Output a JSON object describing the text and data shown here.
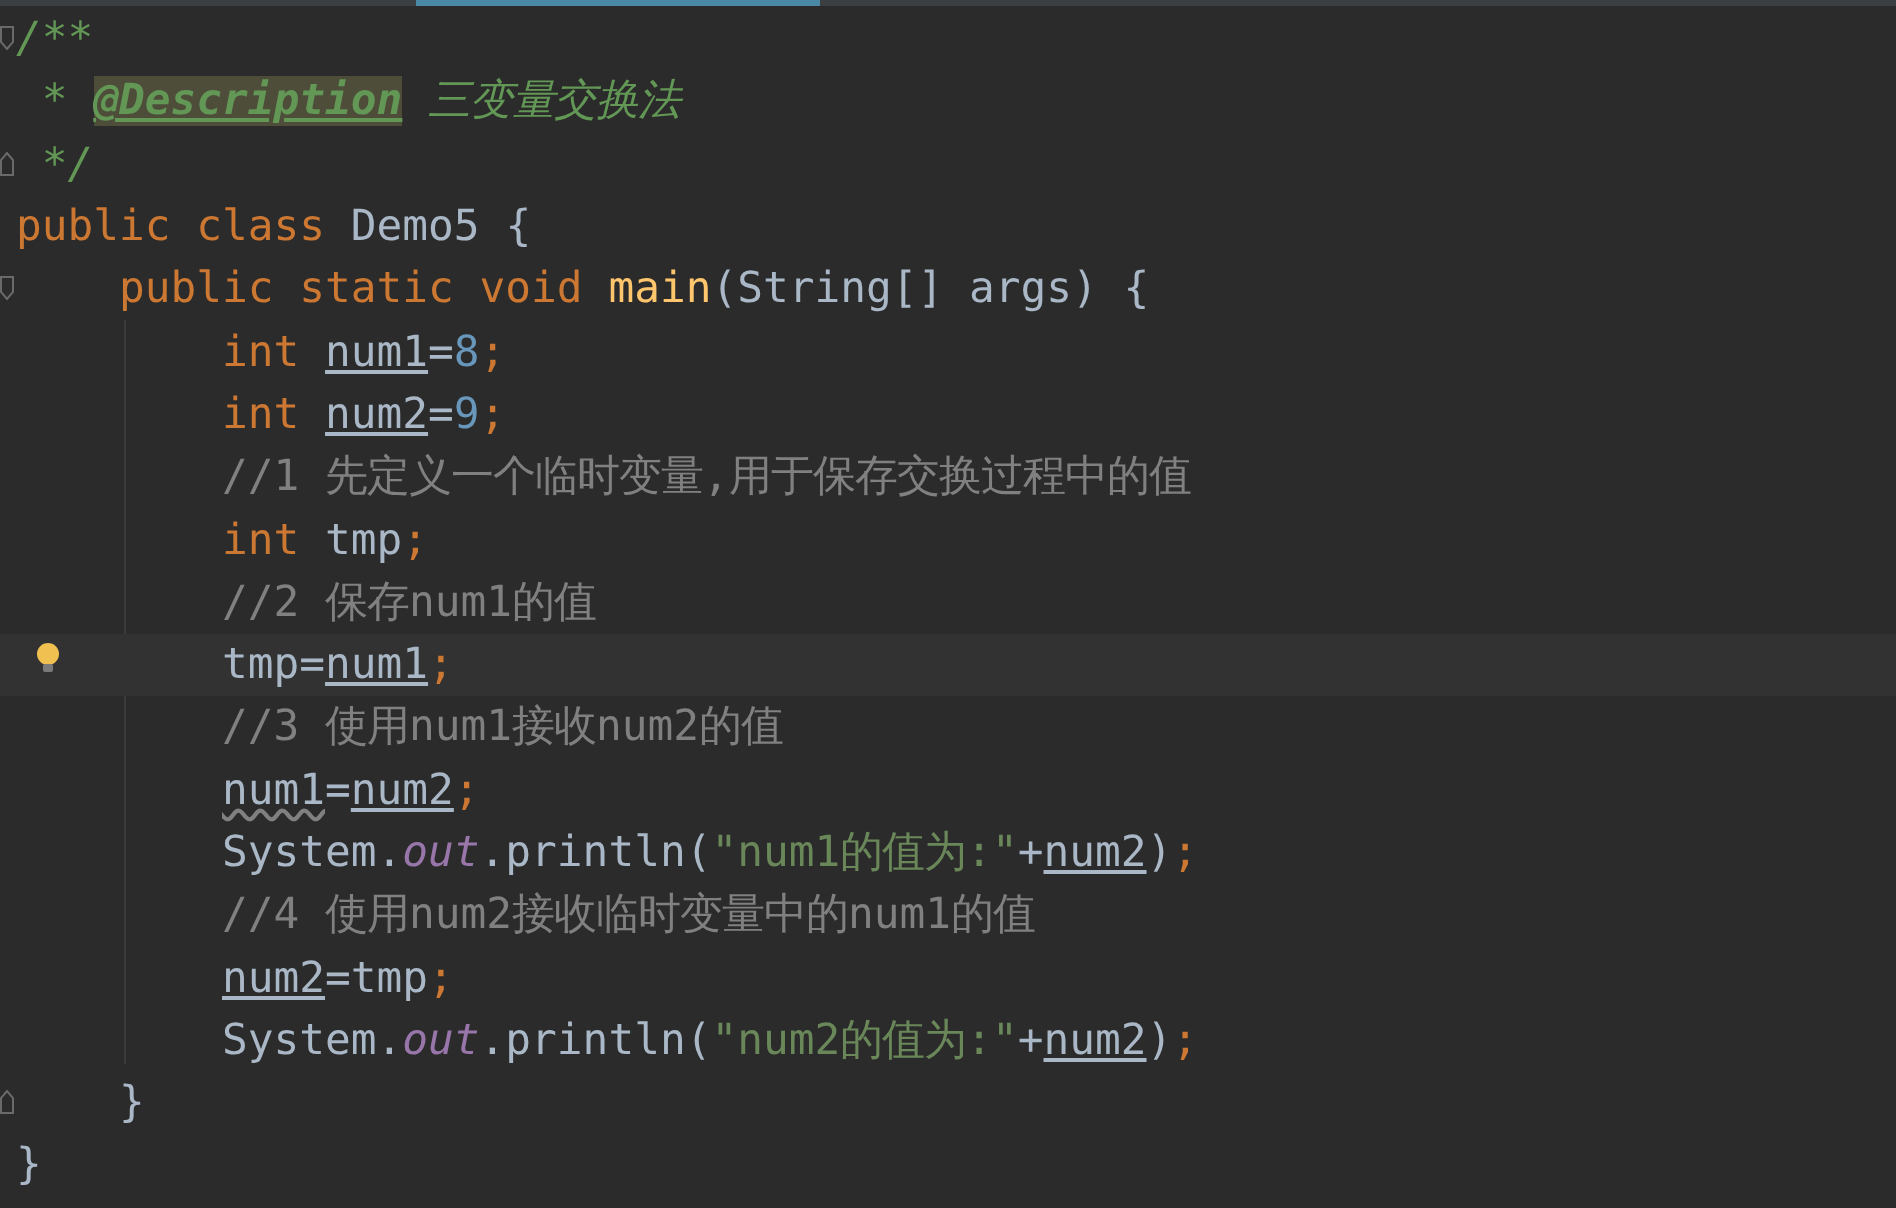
{
  "editor": {
    "lines": [
      {
        "fold_start": true,
        "fold_end": false,
        "current": false,
        "tokens": [
          {
            "kind": "doc",
            "text": "/**"
          }
        ]
      },
      {
        "fold_start": false,
        "fold_end": false,
        "current": false,
        "tokens": [
          {
            "kind": "doc",
            "text": " * "
          },
          {
            "kind": "doctag",
            "text": "@Description"
          },
          {
            "kind": "doc",
            "text": " 三变量交换法"
          }
        ]
      },
      {
        "fold_start": false,
        "fold_end": true,
        "current": false,
        "tokens": [
          {
            "kind": "doc",
            "text": " */"
          }
        ]
      },
      {
        "fold_start": false,
        "fold_end": false,
        "current": false,
        "tokens": [
          {
            "kind": "keyword",
            "text": "public class "
          },
          {
            "kind": "plain",
            "text": "Demo5 {"
          }
        ],
        "children": [
          {
            "fold_start": true,
            "fold_end": false,
            "current": false,
            "tokens": [
              {
                "kind": "keyword",
                "text": "public static void "
              },
              {
                "kind": "method",
                "text": "main"
              },
              {
                "kind": "plain",
                "text": "(String[] args) {"
              }
            ],
            "children": [
              {
                "fold_start": false,
                "fold_end": false,
                "current": false,
                "tokens": [
                  {
                    "kind": "keyword",
                    "text": "int "
                  },
                  {
                    "kind": "var",
                    "text": "num1"
                  },
                  {
                    "kind": "plain",
                    "text": "="
                  },
                  {
                    "kind": "number",
                    "text": "8"
                  },
                  {
                    "kind": "keyword",
                    "text": ";"
                  }
                ]
              },
              {
                "fold_start": false,
                "fold_end": false,
                "current": false,
                "tokens": [
                  {
                    "kind": "keyword",
                    "text": "int "
                  },
                  {
                    "kind": "var",
                    "text": "num2"
                  },
                  {
                    "kind": "plain",
                    "text": "="
                  },
                  {
                    "kind": "number",
                    "text": "9"
                  },
                  {
                    "kind": "keyword",
                    "text": ";"
                  }
                ]
              },
              {
                "fold_start": false,
                "fold_end": false,
                "current": false,
                "tokens": [
                  {
                    "kind": "comment",
                    "text": "//1 先定义一个临时变量,用于保存交换过程中的值"
                  }
                ]
              },
              {
                "fold_start": false,
                "fold_end": false,
                "current": false,
                "tokens": [
                  {
                    "kind": "keyword",
                    "text": "int "
                  },
                  {
                    "kind": "plain",
                    "text": "tmp"
                  },
                  {
                    "kind": "keyword",
                    "text": ";"
                  }
                ]
              },
              {
                "fold_start": false,
                "fold_end": false,
                "current": false,
                "tokens": [
                  {
                    "kind": "comment",
                    "text": "//2 保存num1的值"
                  }
                ]
              },
              {
                "fold_start": false,
                "fold_end": false,
                "current": true,
                "tokens": [
                  {
                    "kind": "plain",
                    "text": "tmp="
                  },
                  {
                    "kind": "var",
                    "text": "num1"
                  },
                  {
                    "kind": "keyword",
                    "text": ";"
                  }
                ]
              },
              {
                "fold_start": false,
                "fold_end": false,
                "current": false,
                "tokens": [
                  {
                    "kind": "comment",
                    "text": "//3 使用num1接收num2的值"
                  }
                ]
              },
              {
                "fold_start": false,
                "fold_end": false,
                "current": false,
                "tokens": [
                  {
                    "kind": "warnvar",
                    "text": "num1"
                  },
                  {
                    "kind": "plain",
                    "text": "="
                  },
                  {
                    "kind": "var",
                    "text": "num2"
                  },
                  {
                    "kind": "keyword",
                    "text": ";"
                  }
                ]
              },
              {
                "fold_start": false,
                "fold_end": false,
                "current": false,
                "tokens": [
                  {
                    "kind": "plain",
                    "text": "System."
                  },
                  {
                    "kind": "field",
                    "text": "out"
                  },
                  {
                    "kind": "plain",
                    "text": ".println("
                  },
                  {
                    "kind": "string",
                    "text": "\"num1的值为:\""
                  },
                  {
                    "kind": "plain",
                    "text": "+"
                  },
                  {
                    "kind": "var",
                    "text": "num2"
                  },
                  {
                    "kind": "plain",
                    "text": ")"
                  },
                  {
                    "kind": "keyword",
                    "text": ";"
                  }
                ]
              },
              {
                "fold_start": false,
                "fold_end": false,
                "current": false,
                "tokens": [
                  {
                    "kind": "comment",
                    "text": "//4 使用num2接收临时变量中的num1的值"
                  }
                ]
              },
              {
                "fold_start": false,
                "fold_end": false,
                "current": false,
                "tokens": [
                  {
                    "kind": "var",
                    "text": "num2"
                  },
                  {
                    "kind": "plain",
                    "text": "=tmp"
                  },
                  {
                    "kind": "keyword",
                    "text": ";"
                  }
                ]
              },
              {
                "fold_start": false,
                "fold_end": false,
                "current": false,
                "tokens": [
                  {
                    "kind": "plain",
                    "text": "System."
                  },
                  {
                    "kind": "field",
                    "text": "out"
                  },
                  {
                    "kind": "plain",
                    "text": ".println("
                  },
                  {
                    "kind": "string",
                    "text": "\"num2的值为:\""
                  },
                  {
                    "kind": "plain",
                    "text": "+"
                  },
                  {
                    "kind": "var",
                    "text": "num2"
                  },
                  {
                    "kind": "plain",
                    "text": ")"
                  },
                  {
                    "kind": "keyword",
                    "text": ";"
                  }
                ]
              }
            ]
          },
          {
            "fold_start": false,
            "fold_end": true,
            "current": false,
            "tokens": [
              {
                "kind": "plain",
                "text": "}"
              }
            ]
          }
        ]
      },
      {
        "fold_start": false,
        "fold_end": false,
        "current": false,
        "tokens": [
          {
            "kind": "plain",
            "text": "}"
          }
        ]
      }
    ]
  }
}
